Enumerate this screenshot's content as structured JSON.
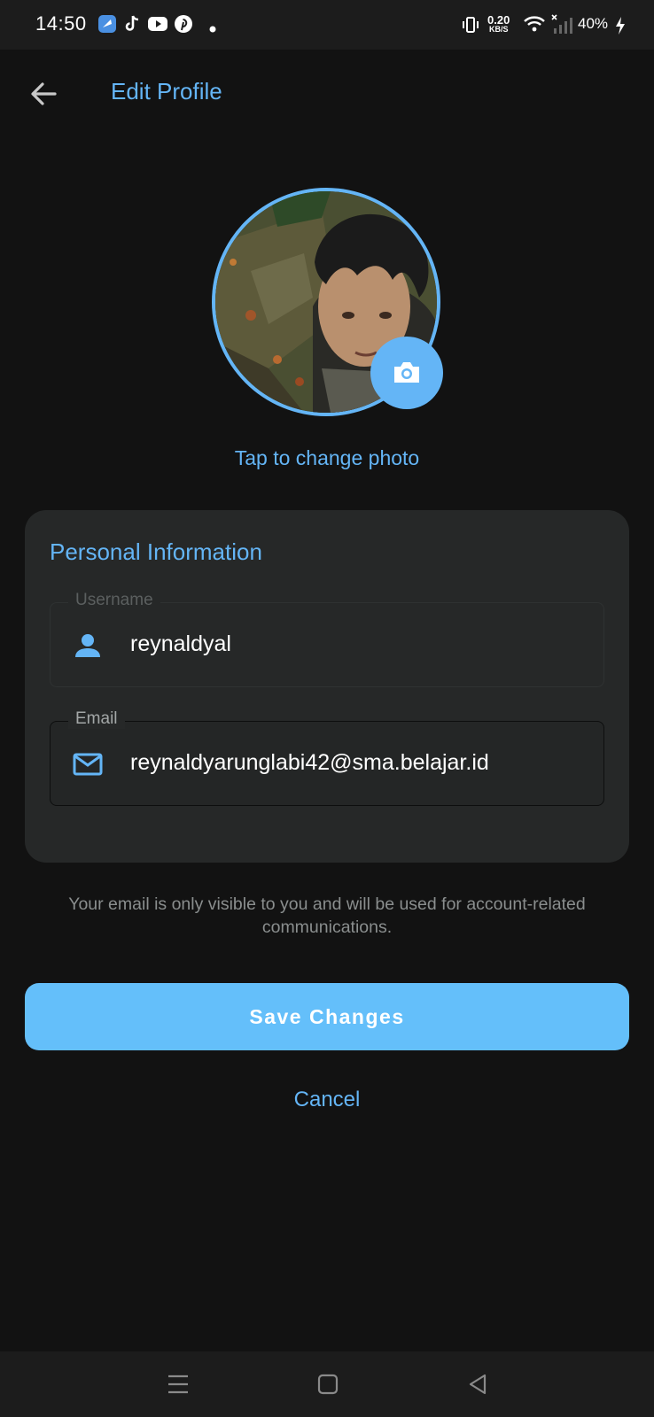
{
  "status_bar": {
    "time": "14:50",
    "notification_icons": [
      "app-icon",
      "tiktok-icon",
      "youtube-icon",
      "pinterest-icon",
      "dot-icon"
    ],
    "net_speed_value": "0.20",
    "net_speed_unit": "KB/S",
    "battery": "40%"
  },
  "header": {
    "title": "Edit Profile"
  },
  "avatar": {
    "change_photo_label": "Tap to change photo"
  },
  "personal_info": {
    "section_title": "Personal Information",
    "username": {
      "label": "Username",
      "value": "reynaldyal"
    },
    "email": {
      "label": "Email",
      "value": "reynaldyarunglabi42@sma.belajar.id"
    }
  },
  "helper_text": "Your email is only visible to you and will be used for account-related communications.",
  "actions": {
    "save_label": "Save Changes",
    "cancel_label": "Cancel"
  },
  "colors": {
    "accent": "#64b5f6",
    "background": "#121212",
    "card": "#262828",
    "save_button": "#64bffa"
  }
}
